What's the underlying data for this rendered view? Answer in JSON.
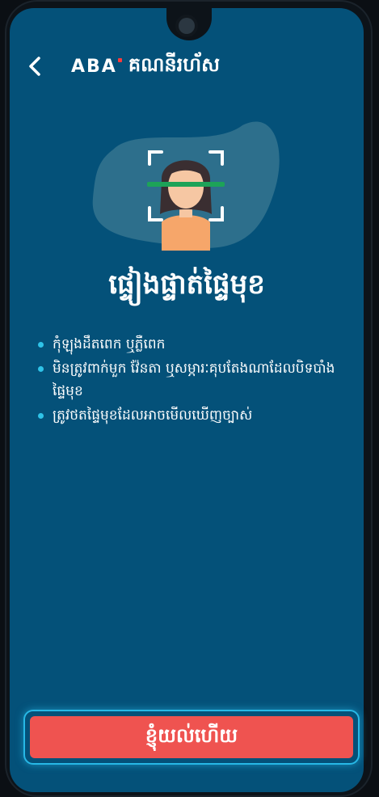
{
  "header": {
    "back_icon": "chevron-left-icon",
    "brand": "ABA",
    "title": "គណនីរហ័ស"
  },
  "hero": {
    "icon": "face-scan-icon"
  },
  "main": {
    "title": "ផ្ទៀងផ្ទាត់ផ្ទៃមុខ",
    "rules": [
      "កុំឡុងដឹតពេក ឬភ្លឺពេក",
      "មិនត្រូវពាក់មួក វ៉ែនតា ឬសម្ភារៈគុបតែងណាដែលបិទបាំងផ្ទៃមុខ",
      "ត្រូវថតផ្ទៃមុខដែលអាចមើលឃើញច្បាស់"
    ]
  },
  "cta": {
    "label": "ខ្ញុំយល់ហើយ"
  },
  "colors": {
    "background": "#045179",
    "accent": "#27b8e6",
    "cta": "#ef5350"
  }
}
